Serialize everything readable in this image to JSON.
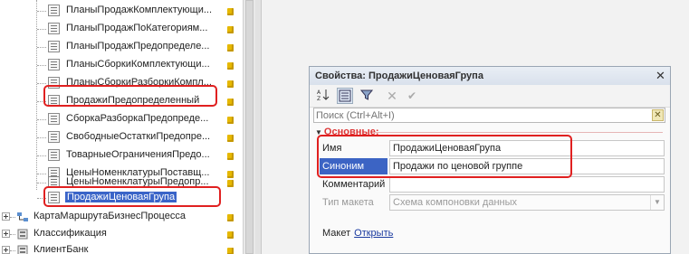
{
  "tree": {
    "children": [
      "ПланыПродажКомплектующи...",
      "ПланыПродажПоКатегориям...",
      "ПланыПродажПредопределе...",
      "ПланыСборкиКомплектующи...",
      "ПланыСборкиРазборкиКомпл...",
      "ПродажиПредопределенный",
      "СборкаРазборкаПредопреде...",
      "СвободныеОстаткиПредопре...",
      "ТоварныеОграниченияПредо...",
      "ЦеныНоменклатурыПоставщ...",
      "ЦеныНоменклатурыПредопр...",
      "ПродажиЦеноваяГрупа"
    ],
    "top_items": [
      "КартаМаршрутаБизнесПроцесса",
      "Классификация",
      "КлиентБанк"
    ]
  },
  "properties": {
    "title": "Свойства: ПродажиЦеноваяГрупа",
    "close_glyph": "✕",
    "search_placeholder": "Поиск (Ctrl+Alt+I)",
    "section": "Основные:",
    "fields": {
      "name_label": "Имя",
      "name_value": "ПродажиЦеноваяГрупа",
      "synonym_label": "Синоним",
      "synonym_value": "Продажи по ценовой группе",
      "comment_label": "Комментарий",
      "comment_value": "",
      "layout_type_label": "Тип макета",
      "layout_type_value": "Схема компоновки данных"
    },
    "maket_label": "Макет",
    "maket_link": "Открыть"
  },
  "colors": {
    "highlight": "#3a64c8",
    "annotation_red": "#e02020",
    "marker": "#e6b800"
  }
}
